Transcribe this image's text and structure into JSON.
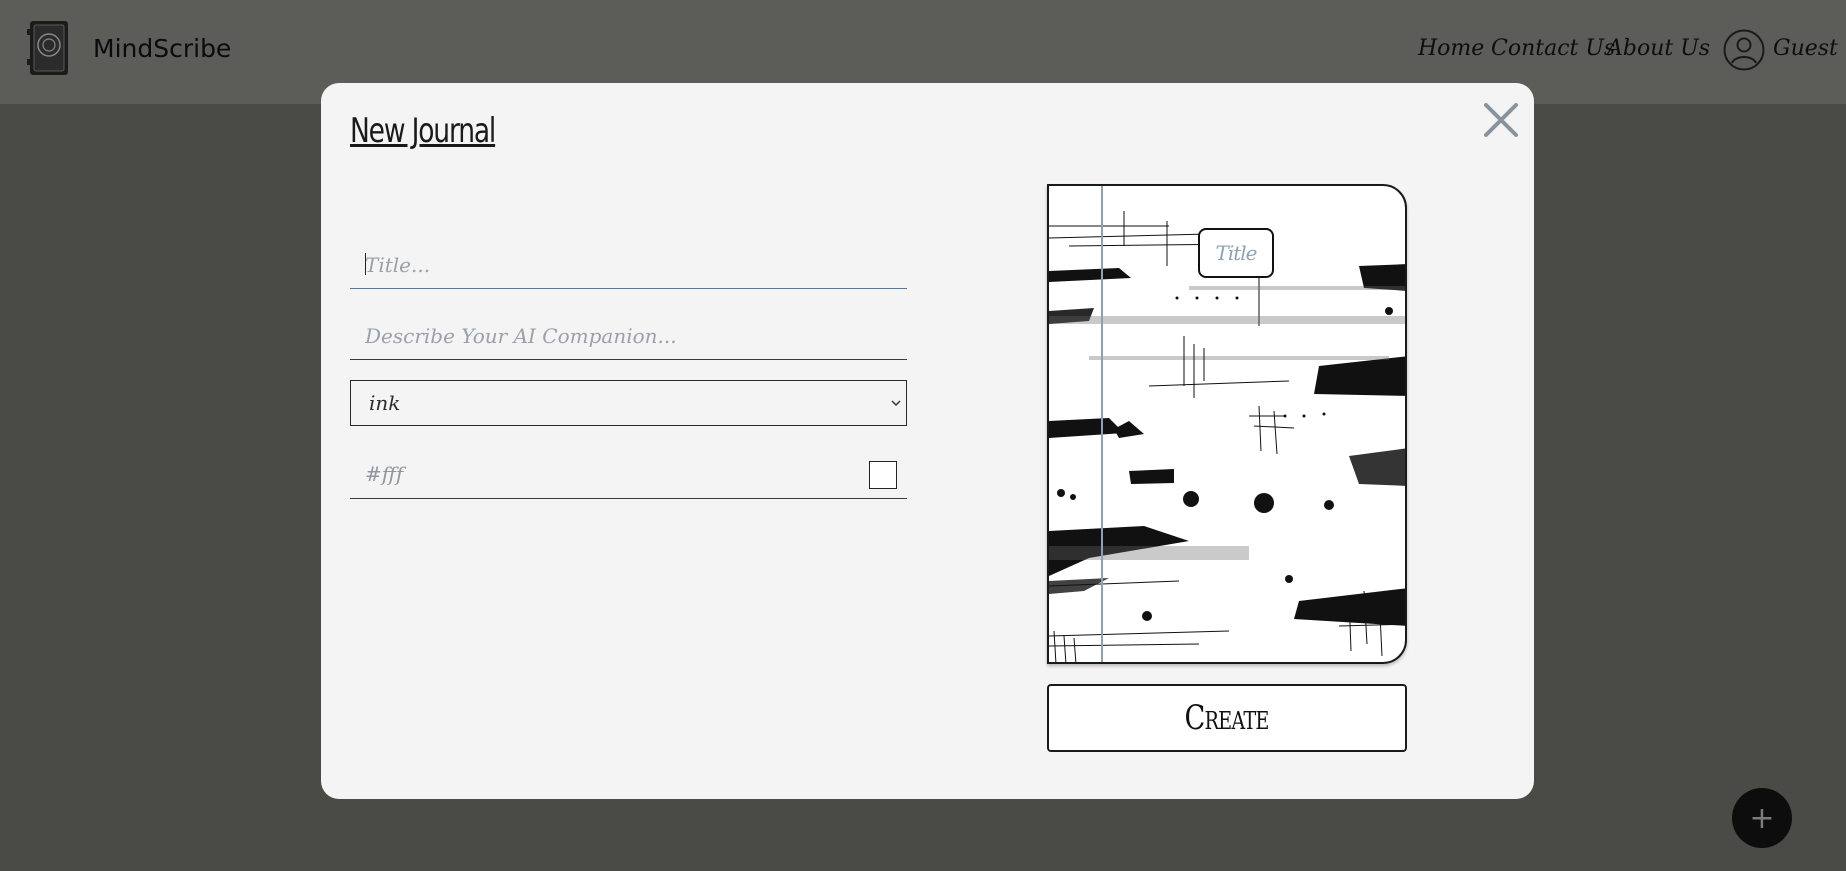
{
  "navbar": {
    "brand_name": "MindScribe",
    "links": [
      "Home",
      "Contact Us",
      "About Us"
    ],
    "user_label": "Guest"
  },
  "modal": {
    "title": "New Journal",
    "title_placeholder": "Title...",
    "description_placeholder": "Describe Your AI Companion...",
    "style_selected": "ink",
    "color_value": "#fff",
    "cover_title": "Title",
    "create_label": "Create"
  },
  "fab": {
    "label": "+"
  },
  "colors": {
    "overlay": "#4a4a47",
    "modal_bg": "#f4f4f4",
    "accent_underline": "#4f7aa6",
    "swatch": "#ffffff"
  },
  "icons": {
    "close": "close-icon",
    "user": "user-circle-icon",
    "logo": "journal-book-icon",
    "chevron": "chevron-down-icon"
  }
}
